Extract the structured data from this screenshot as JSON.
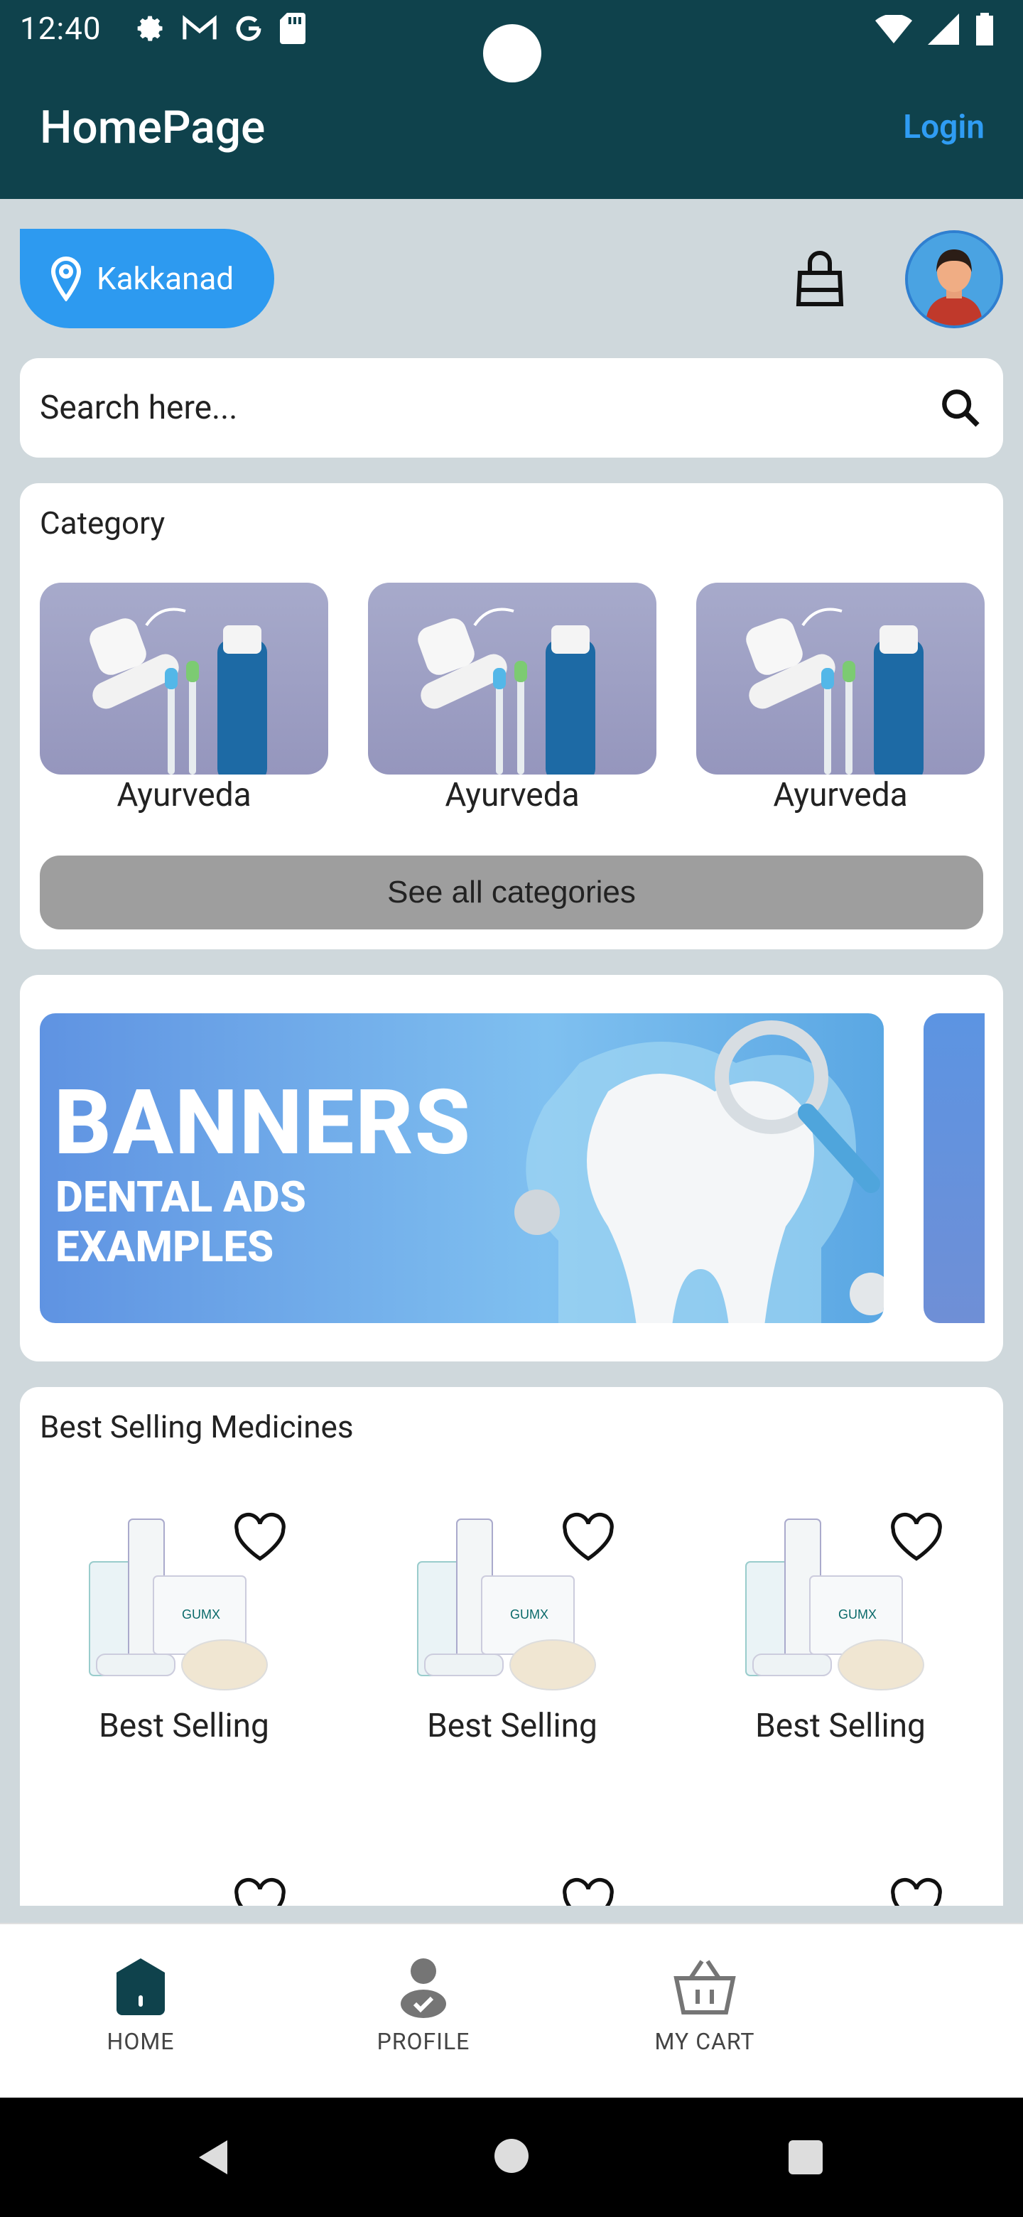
{
  "status_bar": {
    "time": "12:40"
  },
  "app_bar": {
    "title": "HomePage",
    "login_label": "Login"
  },
  "location": {
    "label": "Kakkanad"
  },
  "search": {
    "placeholder": "Search here..."
  },
  "category": {
    "title": "Category",
    "items": [
      {
        "label": "Ayurveda"
      },
      {
        "label": "Ayurveda"
      },
      {
        "label": "Ayurveda"
      }
    ],
    "see_all_label": "See all categories"
  },
  "banner": {
    "headline": "BANNERS",
    "subline": "DENTAL ADS EXAMPLES"
  },
  "best_selling": {
    "title": "Best Selling Medicines",
    "items": [
      {
        "label": "Best Selling"
      },
      {
        "label": "Best Selling"
      },
      {
        "label": "Best Selling"
      }
    ]
  },
  "bottom_nav": {
    "items": [
      {
        "label": "HOME",
        "icon": "home-icon"
      },
      {
        "label": "PROFILE",
        "icon": "profile-icon"
      },
      {
        "label": "MY CART",
        "icon": "cart-icon"
      }
    ]
  },
  "colors": {
    "app_bar": "#0f424c",
    "accent": "#2d9af0",
    "background": "#cfd8dc"
  }
}
